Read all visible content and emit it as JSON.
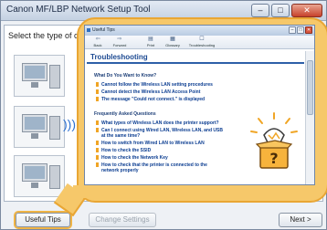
{
  "main_window": {
    "title": "Canon MF/LBP Network Setup Tool",
    "prompt": "Select the type of conne",
    "window_buttons": [
      "–",
      "□",
      "✕"
    ]
  },
  "footer": {
    "useful_tips": "Useful Tips",
    "change_settings": "Change Settings",
    "next": "Next >"
  },
  "help_window": {
    "title": "Useful Tips",
    "toolbar": [
      {
        "label": "Back",
        "icon": "back-icon",
        "glyph": "⇦"
      },
      {
        "label": "Forward",
        "icon": "forward-icon",
        "glyph": "⇨"
      },
      {
        "label": "Print",
        "icon": "print-icon",
        "glyph": "▤"
      },
      {
        "label": "Glossary",
        "icon": "glossary-icon",
        "glyph": "▦"
      },
      {
        "label": "Troubleshooting",
        "icon": "troubleshooting-icon",
        "glyph": "☐"
      }
    ],
    "heading": "Troubleshooting",
    "sections": [
      {
        "title": "What Do You Want to Know?",
        "links": [
          "Cannot follow the Wireless LAN setting procedures",
          "Cannot detect the Wireless LAN Access Point",
          "The message \"Could not connect.\" is displayed"
        ]
      },
      {
        "title": "Frequently Asked Questions",
        "links": [
          "What types of Wireless LAN does the printer support?",
          "Can I connect using Wired LAN, Wireless LAN, and USB at the same time?",
          "How to switch from Wired LAN to Wireless LAN",
          "How to check the SSID",
          "How to check the Network Key",
          "How to check that the printer is connected to the network properly"
        ]
      }
    ]
  },
  "colors": {
    "callout": "#f6c86a",
    "callout_border": "#e9a634",
    "heading_blue": "#1d4a92",
    "bullet": "#f0a525"
  }
}
